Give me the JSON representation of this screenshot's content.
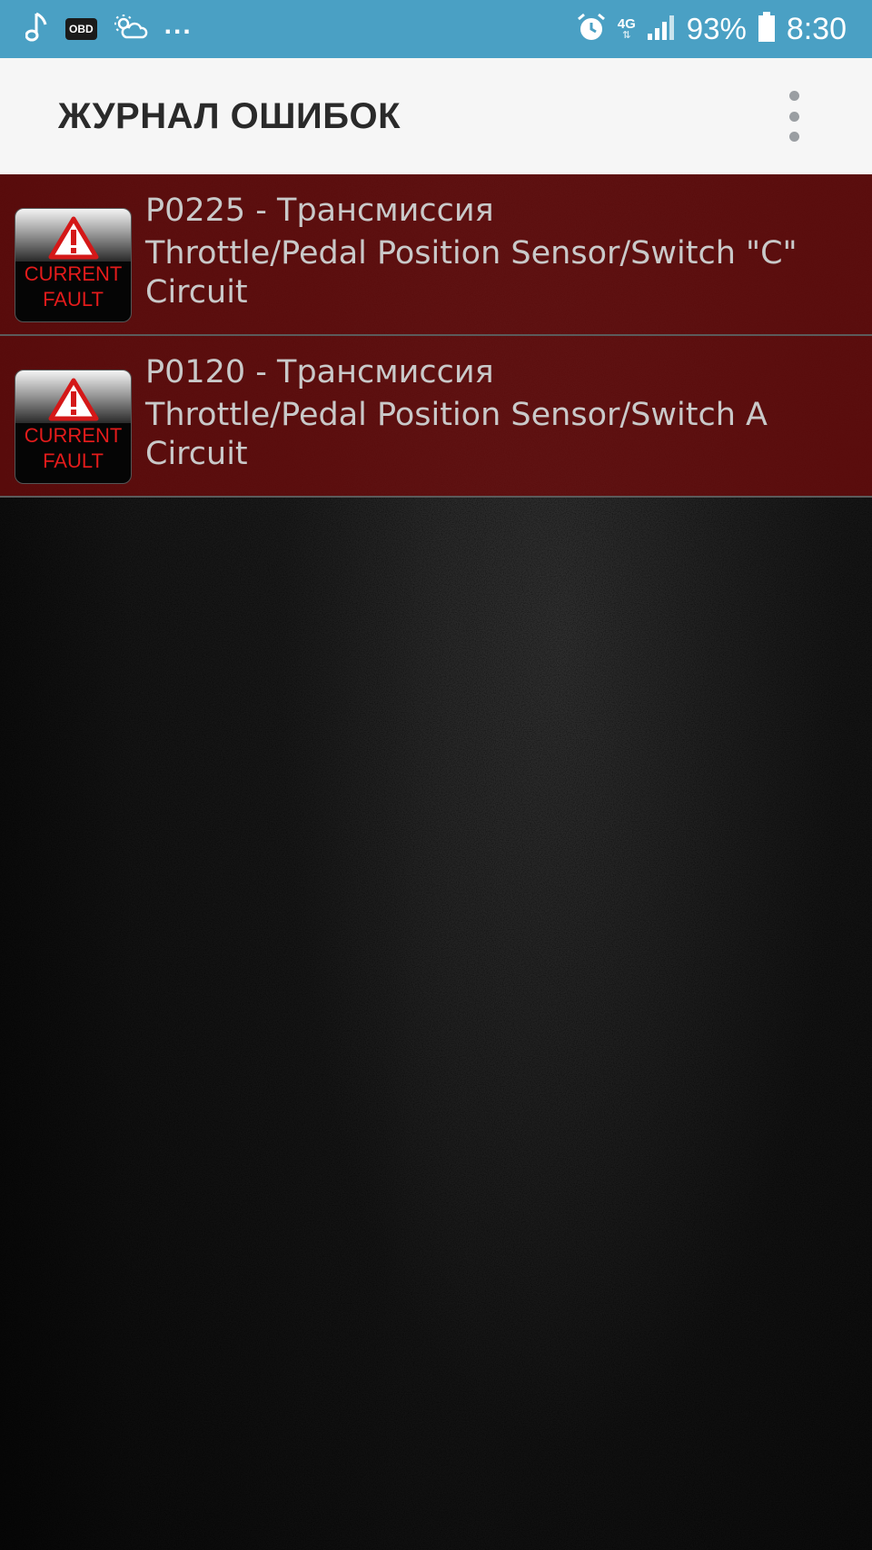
{
  "status_bar": {
    "left_icons": [
      "music-note-icon",
      "obd-icon",
      "weather-icon"
    ],
    "obd_label": "OBD",
    "more_indicator": "...",
    "alarm_icon": "alarm-clock-icon",
    "network_type": "4G",
    "network_arrows": "⇅",
    "signal_icon": "signal-bars-icon",
    "battery_percent": "93%",
    "battery_icon": "battery-icon",
    "time": "8:30",
    "color": "#4aa0c4"
  },
  "app_bar": {
    "title": "ЖУРНАЛ ОШИБОК",
    "menu_icon": "overflow-menu-icon"
  },
  "faults": [
    {
      "code_line": "P0225 - Трансмиссия",
      "description": "Throttle/Pedal Position Sensor/Switch \"C\" Circuit",
      "badge_line1": "CURRENT",
      "badge_line2": "FAULT",
      "badge_icon": "warning-triangle-icon"
    },
    {
      "code_line": "P0120 - Трансмиссия",
      "description": "Throttle/Pedal Position Sensor/Switch A Circuit",
      "badge_line1": "CURRENT",
      "badge_line2": "FAULT",
      "badge_icon": "warning-triangle-icon"
    }
  ],
  "colors": {
    "row_background": "#6e0c0c",
    "fault_text": "#c9c9c9",
    "badge_text": "#e31b1b"
  }
}
